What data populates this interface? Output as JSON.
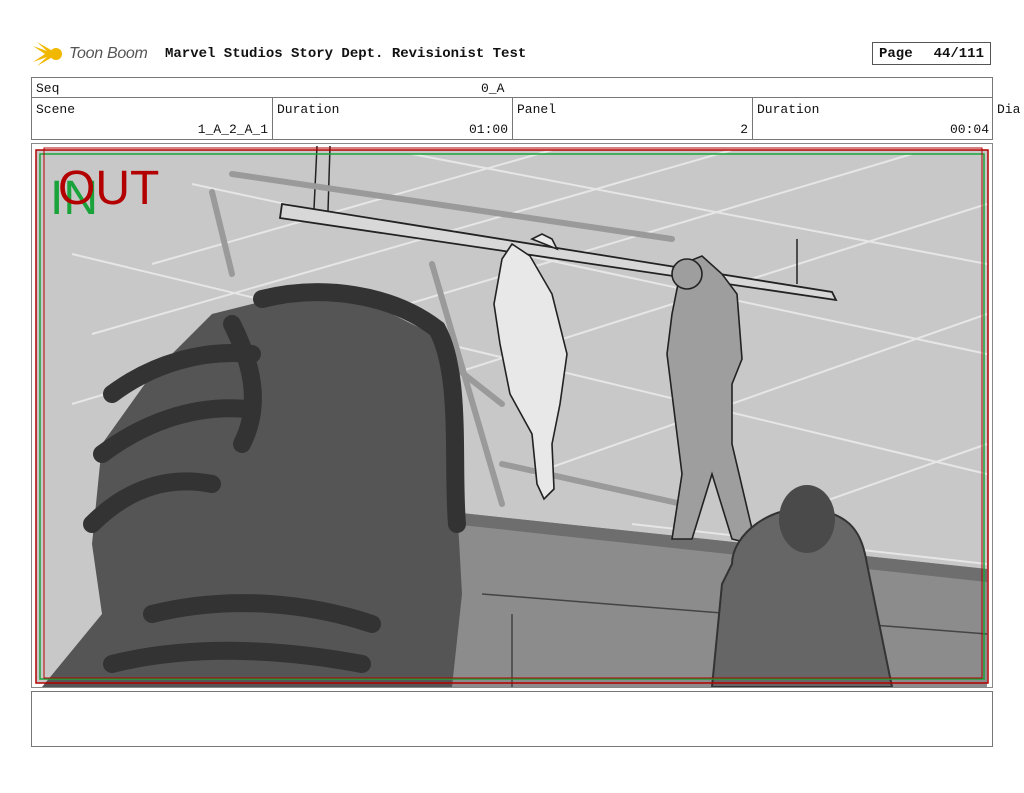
{
  "header": {
    "logo_text": "Toon Boom",
    "title": "Marvel Studios Story Dept. Revisionist Test",
    "page_label": "Page",
    "page_value": "44/111"
  },
  "seq": {
    "label": "Seq",
    "value": "0_A"
  },
  "fields": [
    {
      "label": "Scene",
      "value": "1_A_2_A_1"
    },
    {
      "label": "Duration",
      "value": "01:00"
    },
    {
      "label": "Panel",
      "value": "2"
    },
    {
      "label": "Duration",
      "value": "00:04"
    }
  ],
  "dia_label": "Dia",
  "panel": {
    "in_label": "IN",
    "out_label": "OUT",
    "in_color": "#1aa33a",
    "out_color": "#b30000"
  },
  "notes": {
    "text": ""
  }
}
